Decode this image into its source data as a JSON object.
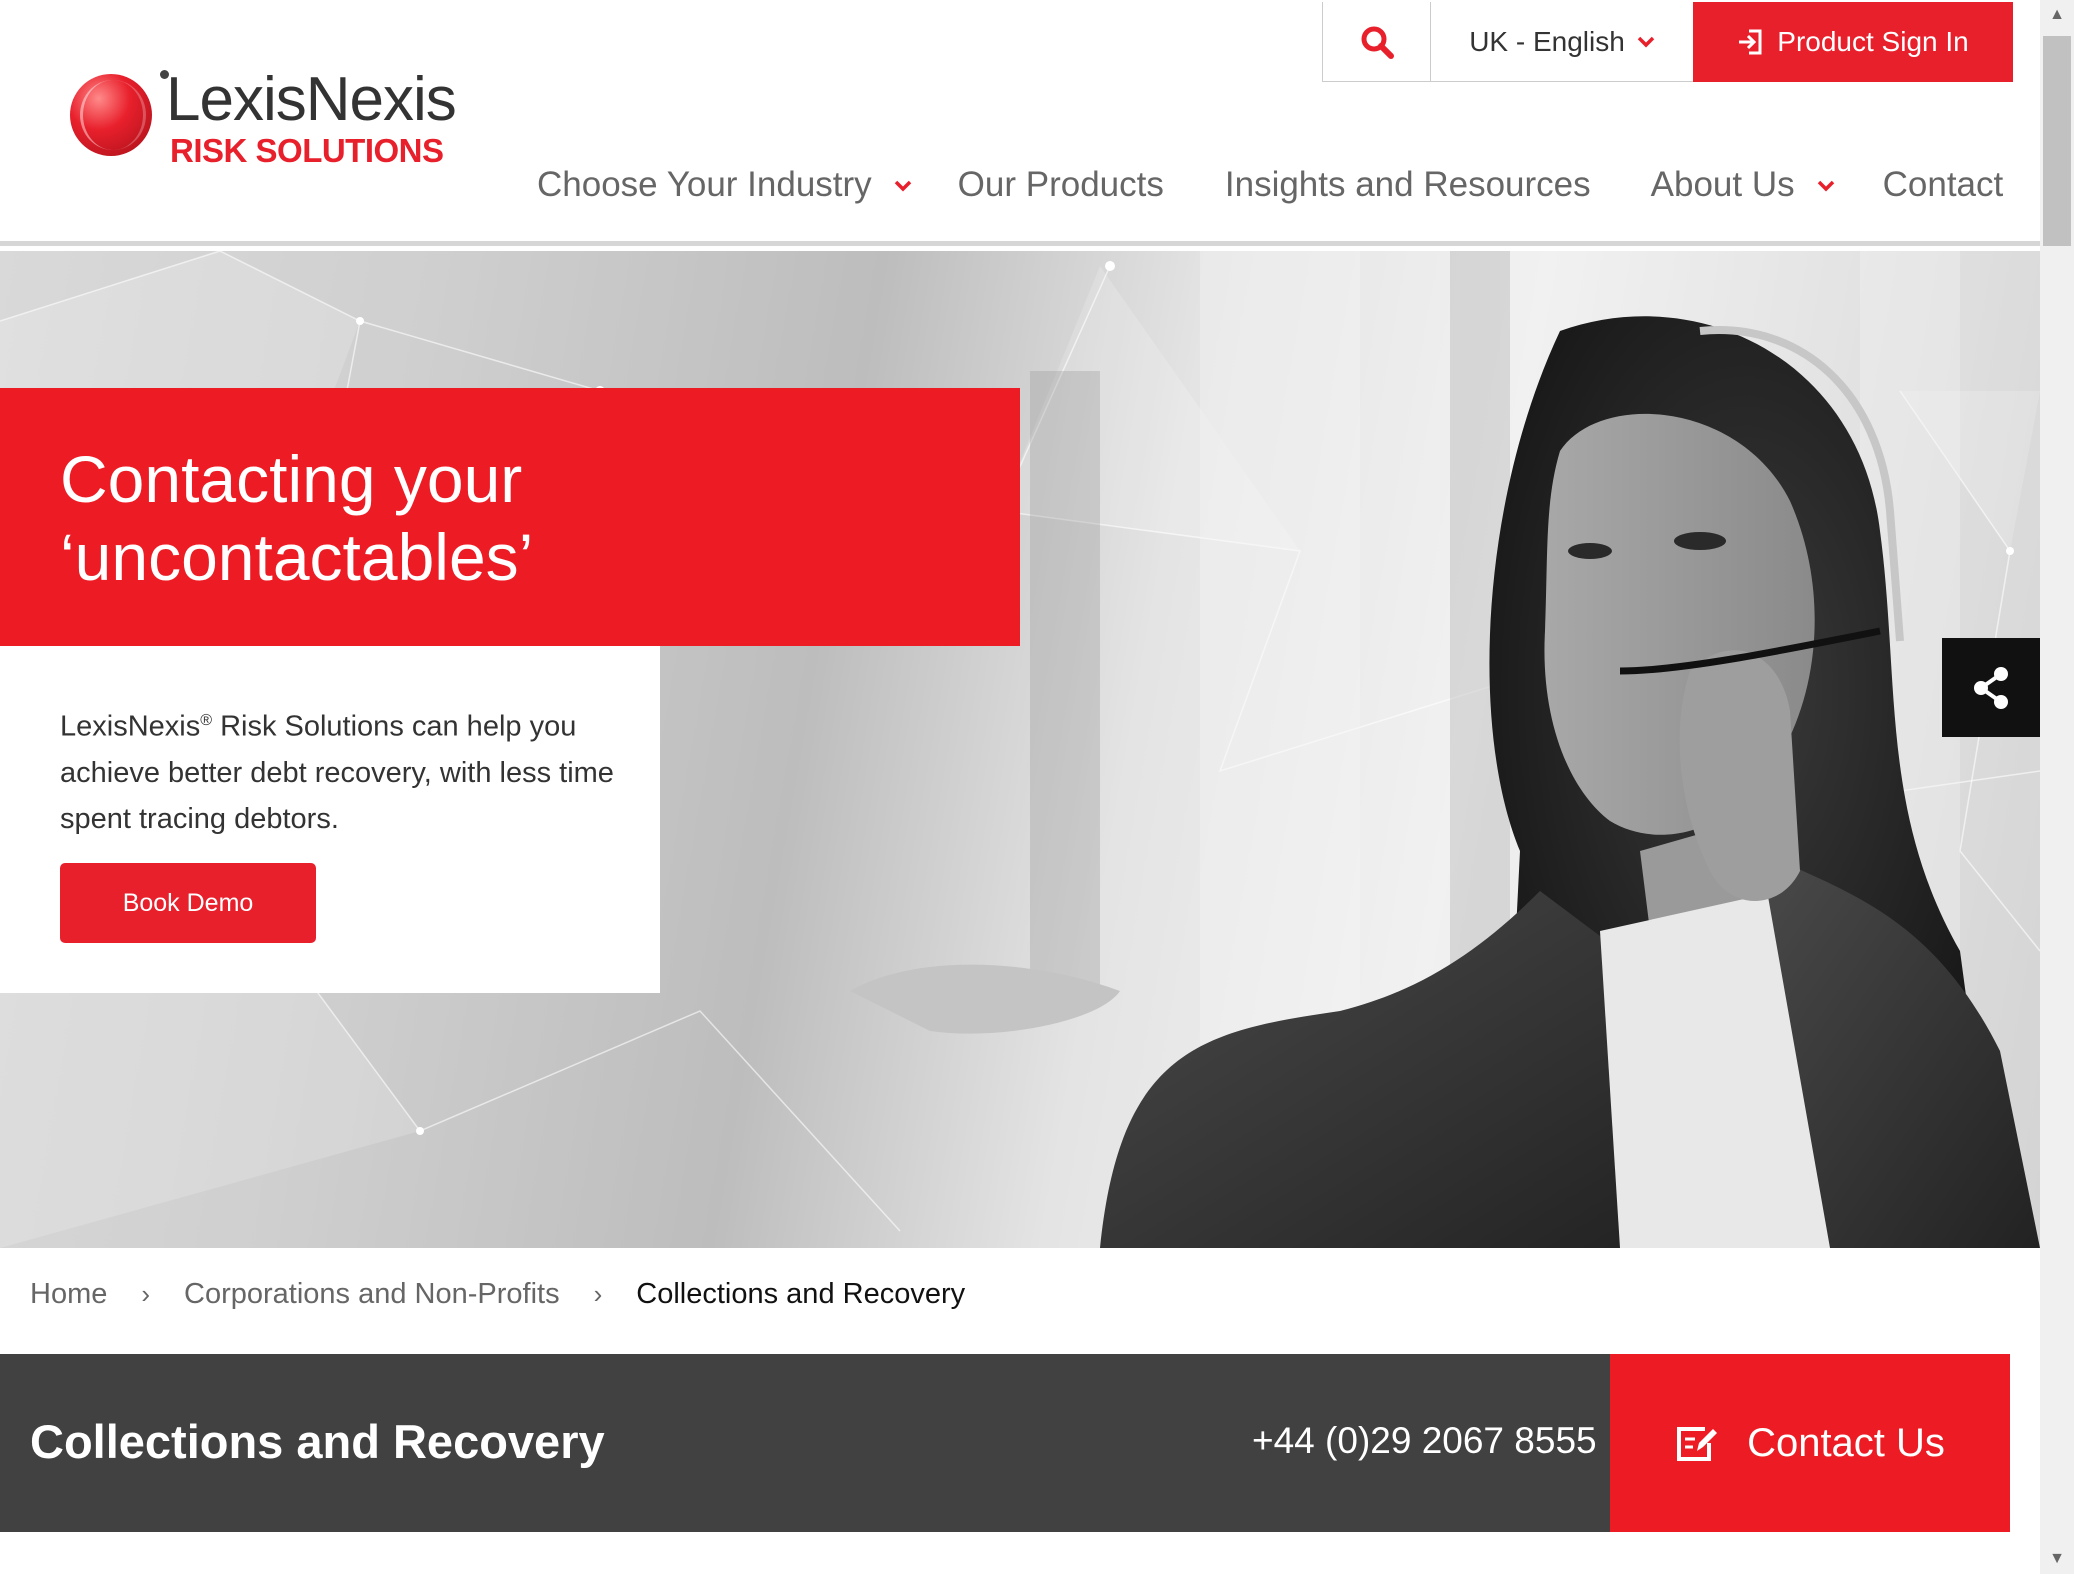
{
  "header": {
    "logo": {
      "brand": "LexisNexis",
      "sub": "RISK SOLUTIONS"
    },
    "utility": {
      "search_icon": "search-icon",
      "language": "UK - English",
      "sign_in": "Product Sign In"
    },
    "nav": [
      {
        "label": "Choose Your Industry",
        "has_dropdown": true
      },
      {
        "label": "Our Products",
        "has_dropdown": false
      },
      {
        "label": "Insights and Resources",
        "has_dropdown": false
      },
      {
        "label": "About Us",
        "has_dropdown": true
      },
      {
        "label": "Contact",
        "has_dropdown": false
      }
    ]
  },
  "hero": {
    "title_line1": "Contacting your",
    "title_line2": "‘uncontactables’",
    "text_brand": "LexisNexis",
    "text_reg": "®",
    "text_rest": " Risk Solutions can help you achieve better debt recovery, with less time spent tracing debtors.",
    "button": "Book Demo",
    "share_icon": "share-icon"
  },
  "breadcrumb": {
    "items": [
      "Home",
      "Corporations and Non-Profits",
      "Collections and Recovery"
    ],
    "separator": "›"
  },
  "section_bar": {
    "title": "Collections and Recovery",
    "phone": "+44 (0)29 2067 8555",
    "contact_button": "Contact Us"
  },
  "colors": {
    "brand_red": "#ed1c24",
    "dark_bar": "#414141"
  }
}
